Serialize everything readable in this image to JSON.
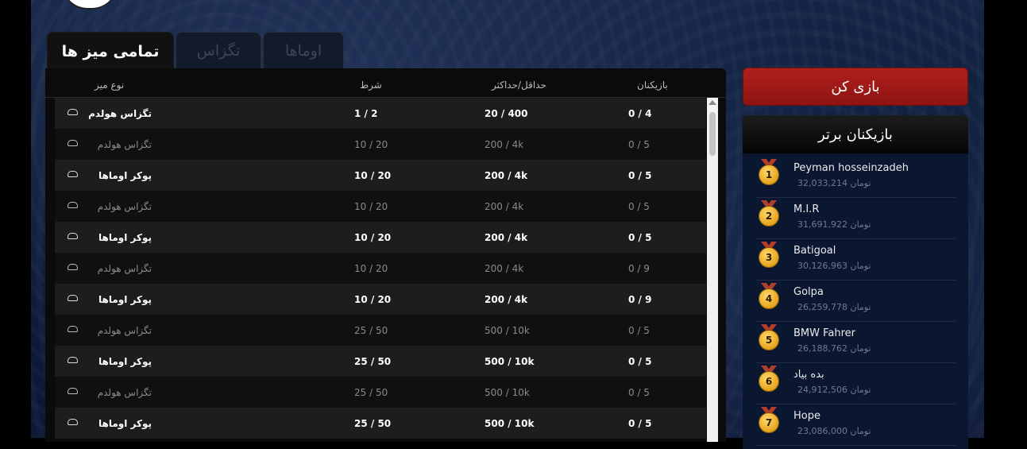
{
  "tabs": [
    {
      "label": "تمامی میز ها",
      "active": true
    },
    {
      "label": "تگزاس",
      "active": false
    },
    {
      "label": "اوماها",
      "active": false
    }
  ],
  "table": {
    "headers": {
      "type": "نوع میز",
      "bet": "شرط",
      "minmax": "حداقل/حداکثر",
      "players": "بازیکنان"
    },
    "rows": [
      {
        "name": "تگزاس هولدم",
        "bet": "1 / 2",
        "minmax": "20 / 400",
        "players": "0 / 4"
      },
      {
        "name": "تگزاس هولدم",
        "bet": "10 / 20",
        "minmax": "200 / 4k",
        "players": "0 / 5"
      },
      {
        "name": "پوکر اوماها",
        "bet": "10 / 20",
        "minmax": "200 / 4k",
        "players": "0 / 5"
      },
      {
        "name": "تگزاس هولدم",
        "bet": "10 / 20",
        "minmax": "200 / 4k",
        "players": "0 / 5"
      },
      {
        "name": "پوکر اوماها",
        "bet": "10 / 20",
        "minmax": "200 / 4k",
        "players": "0 / 5"
      },
      {
        "name": "تگزاس هولدم",
        "bet": "10 / 20",
        "minmax": "200 / 4k",
        "players": "0 / 9"
      },
      {
        "name": "پوکر اوماها",
        "bet": "10 / 20",
        "minmax": "200 / 4k",
        "players": "0 / 9"
      },
      {
        "name": "تگزاس هولدم",
        "bet": "25 / 50",
        "minmax": "500 / 10k",
        "players": "0 / 5"
      },
      {
        "name": "پوکر اوماها",
        "bet": "25 / 50",
        "minmax": "500 / 10k",
        "players": "0 / 5"
      },
      {
        "name": "تگزاس هولدم",
        "bet": "25 / 50",
        "minmax": "500 / 10k",
        "players": "0 / 5"
      },
      {
        "name": "پوکر اوماها",
        "bet": "25 / 50",
        "minmax": "500 / 10k",
        "players": "0 / 5"
      }
    ]
  },
  "play_button": "بازی کن",
  "top_players": {
    "title": "بازیکنان برتر",
    "list": [
      {
        "rank": "1",
        "name": "Peyman hosseinzadeh",
        "money": "32,033,214 تومان"
      },
      {
        "rank": "2",
        "name": "M.I.R",
        "money": "31,691,922 تومان"
      },
      {
        "rank": "3",
        "name": "Batigoal",
        "money": "30,126,963 تومان"
      },
      {
        "rank": "4",
        "name": "Golpa",
        "money": "26,259,778 تومان"
      },
      {
        "rank": "5",
        "name": "BMW Fahrer",
        "money": "26,188,762 تومان"
      },
      {
        "rank": "6",
        "name": "بده بیاد",
        "money": "24,912,506 تومان"
      },
      {
        "rank": "7",
        "name": "Hope",
        "money": "23,086,000 تومان"
      }
    ]
  }
}
